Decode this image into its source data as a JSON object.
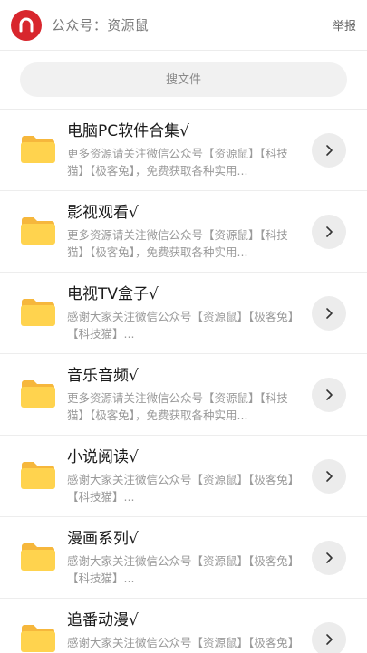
{
  "header": {
    "title": "公众号：资源鼠",
    "report_label": "举报",
    "logo_color": "#d8262d"
  },
  "search": {
    "placeholder": "搜文件"
  },
  "colors": {
    "folder_front": "#ffd34e",
    "folder_back": "#f6b73c",
    "chevron_bg": "#ececec"
  },
  "items": [
    {
      "title": "电脑PC软件合集√",
      "desc": "更多资源请关注微信公众号【资源鼠】【科技猫】【极客兔】，免费获取各种实用...",
      "icon": "folder-icon"
    },
    {
      "title": "影视观看√",
      "desc": "更多资源请关注微信公众号【资源鼠】【科技猫】【极客兔】，免费获取各种实用...",
      "icon": "folder-icon"
    },
    {
      "title": "电视TV盒子√",
      "desc": "感谢大家关注微信公众号【资源鼠】【极客兔】【科技猫】...",
      "icon": "folder-icon"
    },
    {
      "title": "音乐音频√",
      "desc": "更多资源请关注微信公众号【资源鼠】【科技猫】【极客兔】，免费获取各种实用...",
      "icon": "folder-icon"
    },
    {
      "title": "小说阅读√",
      "desc": "感谢大家关注微信公众号【资源鼠】【极客兔】【科技猫】...",
      "icon": "folder-icon"
    },
    {
      "title": "漫画系列√",
      "desc": "感谢大家关注微信公众号【资源鼠】【极客兔】【科技猫】...",
      "icon": "folder-icon"
    },
    {
      "title": "追番动漫√",
      "desc": "感谢大家关注微信公众号【资源鼠】【极客兔】【科技猫】...",
      "icon": "folder-icon"
    }
  ]
}
